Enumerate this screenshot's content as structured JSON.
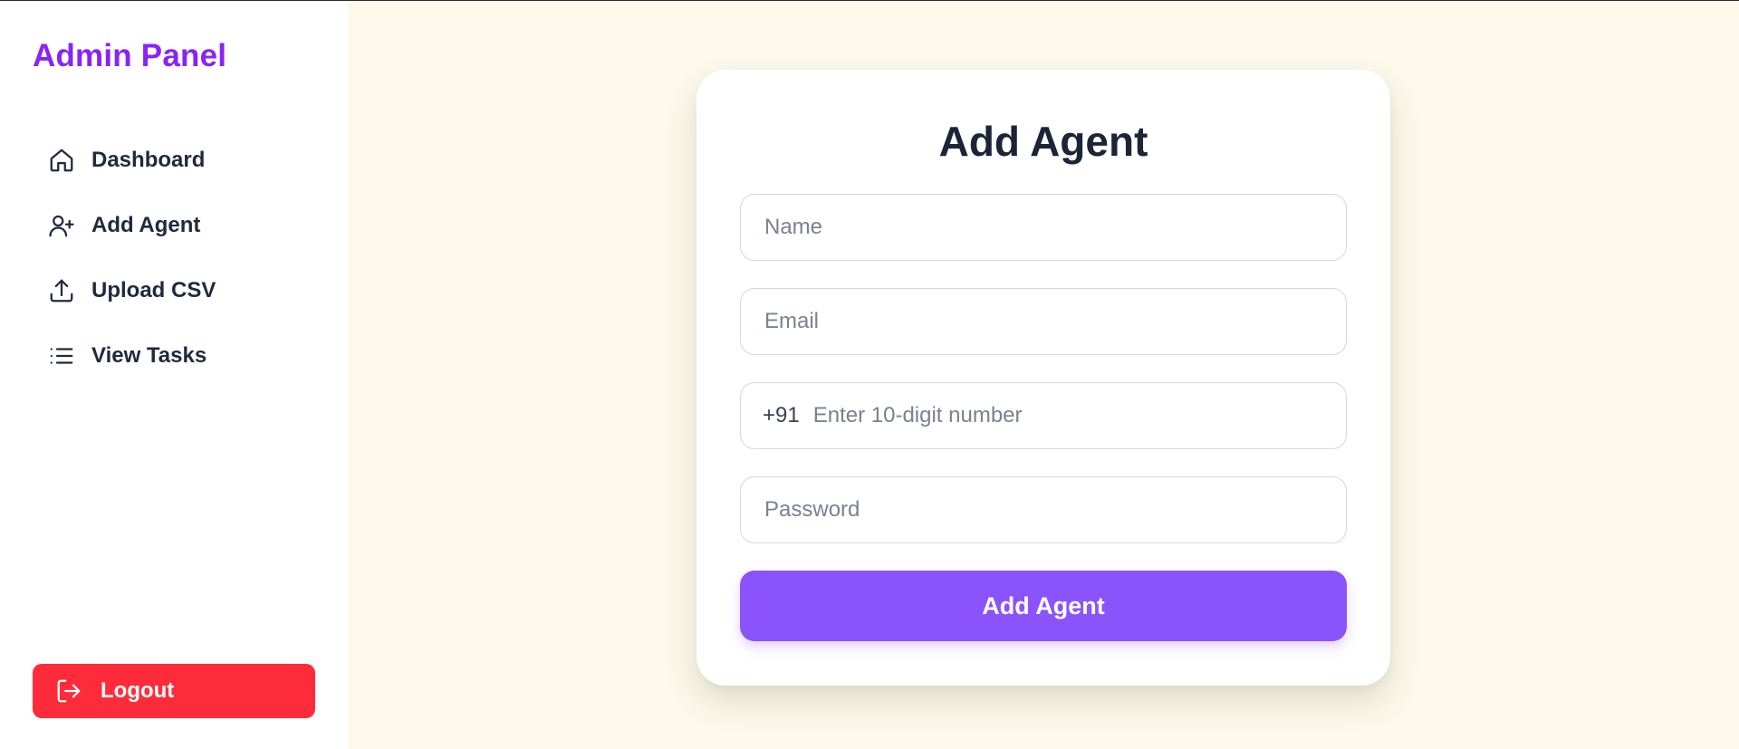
{
  "sidebar": {
    "brand": "Admin Panel",
    "items": [
      {
        "label": "Dashboard",
        "icon": "home-icon"
      },
      {
        "label": "Add Agent",
        "icon": "user-plus-icon"
      },
      {
        "label": "Upload CSV",
        "icon": "upload-icon"
      },
      {
        "label": "View Tasks",
        "icon": "list-icon"
      }
    ],
    "logout_label": "Logout",
    "logout_icon": "logout-icon"
  },
  "form": {
    "title": "Add Agent",
    "name_placeholder": "Name",
    "email_placeholder": "Email",
    "phone_prefix": "+91",
    "phone_placeholder": "Enter 10-digit number",
    "password_placeholder": "Password",
    "submit_label": "Add Agent"
  },
  "colors": {
    "brand": "#8a23f5",
    "page_background": "#fdf9ea",
    "submit_button": "#8b53fb",
    "logout_button": "#fe2c3a",
    "sidebar_background": "#ffffff"
  }
}
